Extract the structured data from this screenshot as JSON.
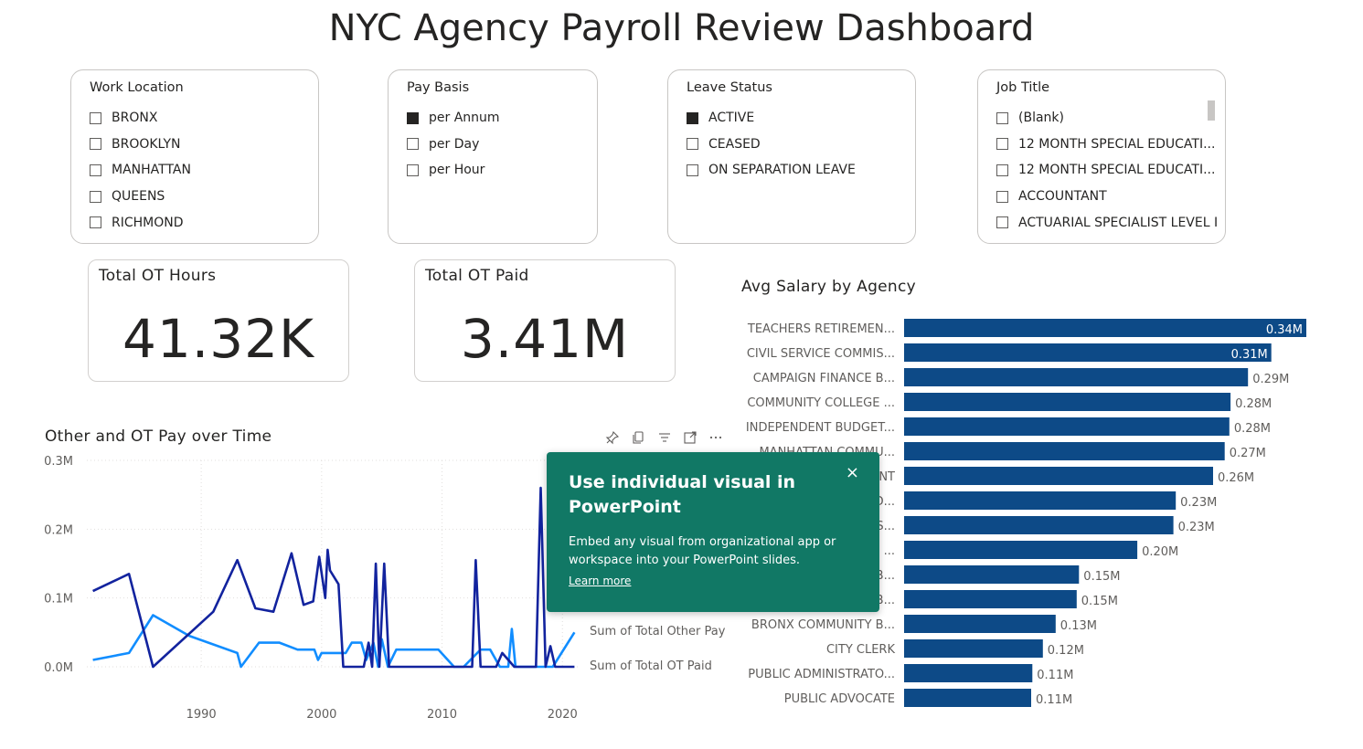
{
  "title": "NYC Agency Payroll Review Dashboard",
  "slicers": {
    "work_location": {
      "header": "Work Location",
      "items": [
        {
          "label": "BRONX",
          "checked": false
        },
        {
          "label": "BROOKLYN",
          "checked": false
        },
        {
          "label": "MANHATTAN",
          "checked": false
        },
        {
          "label": "QUEENS",
          "checked": false
        },
        {
          "label": "RICHMOND",
          "checked": false
        }
      ]
    },
    "pay_basis": {
      "header": "Pay Basis",
      "items": [
        {
          "label": "per Annum",
          "checked": true
        },
        {
          "label": "per Day",
          "checked": false
        },
        {
          "label": "per Hour",
          "checked": false
        }
      ]
    },
    "leave_status": {
      "header": "Leave Status",
      "items": [
        {
          "label": "ACTIVE",
          "checked": true
        },
        {
          "label": "CEASED",
          "checked": false
        },
        {
          "label": "ON SEPARATION LEAVE",
          "checked": false
        }
      ]
    },
    "job_title": {
      "header": "Job Title",
      "items": [
        {
          "label": "(Blank)",
          "checked": false
        },
        {
          "label": "12 MONTH SPECIAL EDUCATI...",
          "checked": false
        },
        {
          "label": "12 MONTH SPECIAL EDUCATI...",
          "checked": false
        },
        {
          "label": "ACCOUNTANT",
          "checked": false
        },
        {
          "label": "ACTUARIAL SPECIALIST LEVEL I",
          "checked": false
        }
      ]
    }
  },
  "cards": {
    "ot_hours": {
      "label": "Total OT Hours",
      "value": "41.32K"
    },
    "ot_paid": {
      "label": "Total OT Paid",
      "value": "3.41M"
    }
  },
  "line_chart_title": "Other and OT Pay over Time",
  "bar_chart_title": "Avg Salary by Agency",
  "visual_header_icons": [
    "pin-icon",
    "copy-icon",
    "filter-icon",
    "focus-mode-icon",
    "more-options-icon"
  ],
  "popup": {
    "title": "Use individual visual in PowerPoint",
    "body": "Embed any visual from organizational app or workspace into your PowerPoint slides.",
    "link": "Learn more",
    "close": "×",
    "background": "#117865"
  },
  "colors": {
    "ot_paid_line": "#12239e",
    "other_pay_line": "#118dff",
    "bar": "#0d4a87"
  },
  "chart_data": [
    {
      "type": "line",
      "title": "Other and OT Pay over Time",
      "y_ticks": [
        "0.3M",
        "0.2M",
        "0.1M",
        "0.0M"
      ],
      "x_ticks": [
        "1990",
        "2000",
        "2010",
        "2020"
      ],
      "ylim": [
        0,
        300000
      ],
      "xlim": [
        1980.5,
        2021.5
      ],
      "series": [
        {
          "name": "Sum of Total OT Paid",
          "color": "#12239e",
          "points": [
            [
              1981,
              110000
            ],
            [
              1984,
              135000
            ],
            [
              1986,
              0
            ],
            [
              1991,
              80000
            ],
            [
              1993,
              155000
            ],
            [
              1994.5,
              85000
            ],
            [
              1996,
              80000
            ],
            [
              1997.5,
              165000
            ],
            [
              1998.5,
              90000
            ],
            [
              1999.3,
              95000
            ],
            [
              1999.8,
              160000
            ],
            [
              2000.3,
              100000
            ],
            [
              2000.5,
              170000
            ],
            [
              2000.7,
              140000
            ],
            [
              2001.4,
              120000
            ],
            [
              2001.8,
              0
            ],
            [
              2003.5,
              0
            ],
            [
              2003.9,
              35000
            ],
            [
              2004.2,
              0
            ],
            [
              2004.5,
              150000
            ],
            [
              2004.8,
              0
            ],
            [
              2005.2,
              150000
            ],
            [
              2005.6,
              0
            ],
            [
              2006.1,
              0
            ],
            [
              2010,
              0
            ],
            [
              2012.5,
              0
            ],
            [
              2012.8,
              155000
            ],
            [
              2013.2,
              0
            ],
            [
              2014.5,
              0
            ],
            [
              2015,
              20000
            ],
            [
              2016,
              0
            ],
            [
              2017.8,
              0
            ],
            [
              2018.2,
              260000
            ],
            [
              2018.6,
              0
            ],
            [
              2019,
              30000
            ],
            [
              2019.4,
              0
            ],
            [
              2021,
              0
            ]
          ]
        },
        {
          "name": "Sum of Total Other Pay",
          "color": "#118dff",
          "points": [
            [
              1981,
              10000
            ],
            [
              1984,
              20000
            ],
            [
              1986,
              75000
            ],
            [
              1989,
              45000
            ],
            [
              1993,
              20000
            ],
            [
              1993.3,
              0
            ],
            [
              1994.8,
              35000
            ],
            [
              1996.5,
              35000
            ],
            [
              1998,
              25000
            ],
            [
              1999.4,
              25000
            ],
            [
              1999.7,
              10000
            ],
            [
              2000,
              20000
            ],
            [
              2001.5,
              20000
            ],
            [
              2002,
              20000
            ],
            [
              2002.5,
              35000
            ],
            [
              2003.3,
              35000
            ],
            [
              2003.7,
              10000
            ],
            [
              2004.3,
              35000
            ],
            [
              2004.7,
              0
            ],
            [
              2005,
              40000
            ],
            [
              2005.5,
              0
            ],
            [
              2006.2,
              25000
            ],
            [
              2009.7,
              25000
            ],
            [
              2011,
              0
            ],
            [
              2011.8,
              0
            ],
            [
              2013.2,
              25000
            ],
            [
              2014,
              25000
            ],
            [
              2014.8,
              0
            ],
            [
              2015.5,
              0
            ],
            [
              2015.8,
              55000
            ],
            [
              2016.1,
              0
            ],
            [
              2018,
              0
            ],
            [
              2018.3,
              0
            ],
            [
              2019.2,
              0
            ],
            [
              2021,
              50000
            ]
          ]
        }
      ]
    },
    {
      "type": "bar",
      "title": "Avg Salary by Agency",
      "orientation": "horizontal",
      "categories": [
        "TEACHERS RETIREMEN...",
        "CIVIL SERVICE COMMIS...",
        "CAMPAIGN FINANCE B...",
        "COMMUNITY COLLEGE ...",
        "INDEPENDENT BUDGET...",
        "MANHATTAN COMMU...",
        "...NT",
        "...D...",
        "...S...",
        "... ...",
        "...B...",
        "...B...",
        "BRONX COMMUNITY B...",
        "CITY CLERK",
        "PUBLIC ADMINISTRATO...",
        "PUBLIC ADVOCATE"
      ],
      "values": [
        0.345,
        0.315,
        0.295,
        0.28,
        0.279,
        0.275,
        0.265,
        0.233,
        0.231,
        0.2,
        0.15,
        0.148,
        0.13,
        0.119,
        0.11,
        0.109
      ],
      "labels": [
        "0.34M",
        "0.31M",
        "0.29M",
        "0.28M",
        "0.28M",
        "0.27M",
        "0.26M",
        "0.23M",
        "0.23M",
        "0.20M",
        "0.15M",
        "0.15M",
        "0.13M",
        "0.12M",
        "0.11M",
        "0.11M"
      ],
      "xlim": [
        0,
        0.345
      ]
    }
  ]
}
